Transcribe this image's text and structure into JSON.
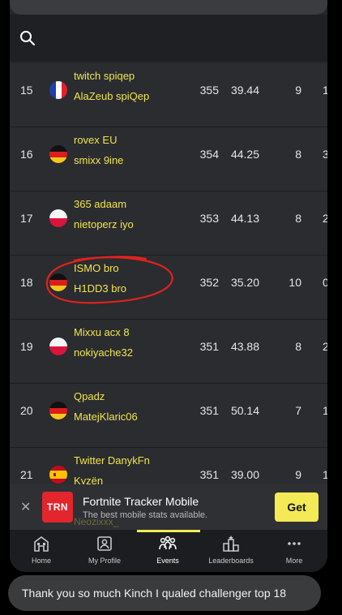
{
  "rows": [
    {
      "rank": "15",
      "country": "france",
      "player1": "twitch spiqep",
      "player2": "AlaZeub spiQep",
      "points": "355",
      "avg": "39.44",
      "wins": "9",
      "extra": "1"
    },
    {
      "rank": "16",
      "country": "germany",
      "player1": "rovex EU",
      "player2": "smixx 9ine",
      "points": "354",
      "avg": "44.25",
      "wins": "8",
      "extra": "3"
    },
    {
      "rank": "17",
      "country": "poland",
      "player1": "365 adaam",
      "player2": "nietoperz iyo",
      "points": "353",
      "avg": "44.13",
      "wins": "8",
      "extra": "2"
    },
    {
      "rank": "18",
      "country": "germany",
      "player1": "ISMO bro",
      "player2": "H1DD3 bro",
      "points": "352",
      "avg": "35.20",
      "wins": "10",
      "extra": "0"
    },
    {
      "rank": "19",
      "country": "poland",
      "player1": "Mixxu acx 8",
      "player2": "nokiyache32",
      "points": "351",
      "avg": "43.88",
      "wins": "8",
      "extra": "2"
    },
    {
      "rank": "20",
      "country": "germany",
      "player1": "Qpadz",
      "player2": "MatejKlaric06",
      "points": "351",
      "avg": "50.14",
      "wins": "7",
      "extra": "1"
    },
    {
      "rank": "21",
      "country": "spain",
      "player1": "Twitter DanykFn",
      "player2": "Kyzën",
      "points": "351",
      "avg": "39.00",
      "wins": "9",
      "extra": "1"
    }
  ],
  "ad": {
    "logo": "TRN",
    "title": "Fortnite Tracker Mobile",
    "subtitle": "The best mobile stats available.",
    "button": "Get",
    "close": "✕"
  },
  "peek_text": "Neozixxx_",
  "nav": [
    {
      "label": "Home",
      "icon": "home-icon"
    },
    {
      "label": "My Profile",
      "icon": "profile-icon"
    },
    {
      "label": "Events",
      "icon": "events-icon",
      "active": true
    },
    {
      "label": "Leaderboards",
      "icon": "leaderboards-icon"
    },
    {
      "label": "More",
      "icon": "more-icon"
    }
  ],
  "message": "Thank you so much Kinch I qualed challenger top 18",
  "colors": {
    "accent": "#f3ea55",
    "name": "#f2e54c",
    "annotation": "#e0221e",
    "ad_logo": "#e2262b"
  }
}
